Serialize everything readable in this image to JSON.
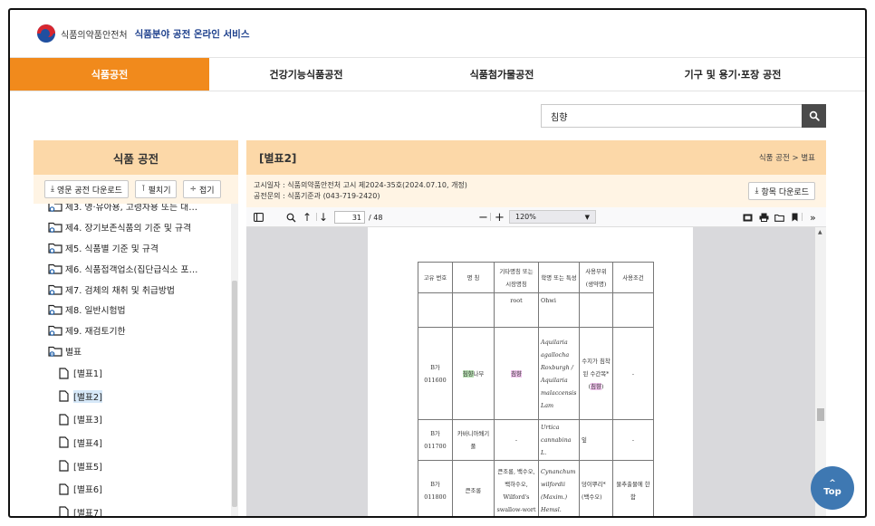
{
  "header": {
    "org_name": "식품의약품안전처",
    "service_name": "식품분야 공전 온라인 서비스"
  },
  "nav": {
    "tabs": [
      {
        "label": "식품공전",
        "active": true
      },
      {
        "label": "건강기능식품공전",
        "active": false
      },
      {
        "label": "식품첨가물공전",
        "active": false
      },
      {
        "label": "기구 및 용기·포장 공전",
        "active": false
      }
    ]
  },
  "search": {
    "value": "침향"
  },
  "left_panel": {
    "title": "식품 공전",
    "buttons": {
      "english_download": "영문 공전 다운로드",
      "expand": "펼치기",
      "collapse": "접기"
    },
    "tree": [
      {
        "label": "제3. 영·유아용, 고령자용 또는 대…",
        "type": "folder"
      },
      {
        "label": "제4. 장기보존식품의 기준 및 규격",
        "type": "folder"
      },
      {
        "label": "제5. 식품별 기준 및 규격",
        "type": "folder"
      },
      {
        "label": "제6. 식품접객업소(집단급식소 포…",
        "type": "folder"
      },
      {
        "label": "제7. 검체의 채취 및 취급방법",
        "type": "folder"
      },
      {
        "label": "제8. 일반시험법",
        "type": "folder"
      },
      {
        "label": "제9. 재검토기한",
        "type": "folder"
      },
      {
        "label": "별표",
        "type": "folder-open"
      },
      {
        "label": "[별표1]",
        "type": "file"
      },
      {
        "label": "[별표2]",
        "type": "file",
        "selected": true
      },
      {
        "label": "[별표3]",
        "type": "file"
      },
      {
        "label": "[별표4]",
        "type": "file"
      },
      {
        "label": "[별표5]",
        "type": "file"
      },
      {
        "label": "[별표6]",
        "type": "file"
      },
      {
        "label": "[별표7]",
        "type": "file"
      }
    ]
  },
  "right_panel": {
    "title": "[별표2]",
    "breadcrumb": "식품 공전 > 별표",
    "notice": "고시일자 : 식품의약품안전처 고시 제2024-35호(2024.07.10, 개정)",
    "contact": "공전문의 : 식품기준과 (043-719-2420)",
    "download_label": "항목 다운로드"
  },
  "pdf_viewer": {
    "current_page": "31",
    "total_pages": "/ 48",
    "zoom": "120%",
    "table": {
      "headers": [
        "고유 번호",
        "명 칭",
        "기타명칭 또는 시장명칭",
        "학명 또는 특성",
        "사용부위 (생약명)",
        "사용조건"
      ],
      "rows": [
        {
          "id": "",
          "name": "",
          "other": "root",
          "sci": "Ohwi",
          "part": "",
          "cond": ""
        },
        {
          "id": "B가011600",
          "name_hl": "침향",
          "name_rest": "나무",
          "other_hl": "침향",
          "sci": "Aquilaria agallocha Roxburgh / Aquilaria malaccensis Lam",
          "part": "수지가 침착된 수간목*(",
          "part_hl": "침향",
          "part_end": ")",
          "cond": "-"
        },
        {
          "id": "B가011700",
          "name": "카바니아쐐기풀",
          "other": "-",
          "sci": "Urtica cannabina L.",
          "part": "잎",
          "cond": "-"
        },
        {
          "id": "B가011800",
          "name": "큰조롱",
          "other": "큰조롱, 백수오, 백하수오, Wilford's swallow-wort",
          "sci": "Cynanchum wilfordii (Maxim.) Hemsl.",
          "part": "덩이뿌리*(백수오)",
          "cond": "물추출물에 한함"
        }
      ]
    }
  },
  "top_button": {
    "label": "Top"
  },
  "colors": {
    "accent_orange": "#f18a1c",
    "panel_header": "#fcd8a8",
    "panel_sub": "#fff4e4",
    "brand_blue": "#1c3f8c",
    "top_button": "#3e78b2"
  }
}
